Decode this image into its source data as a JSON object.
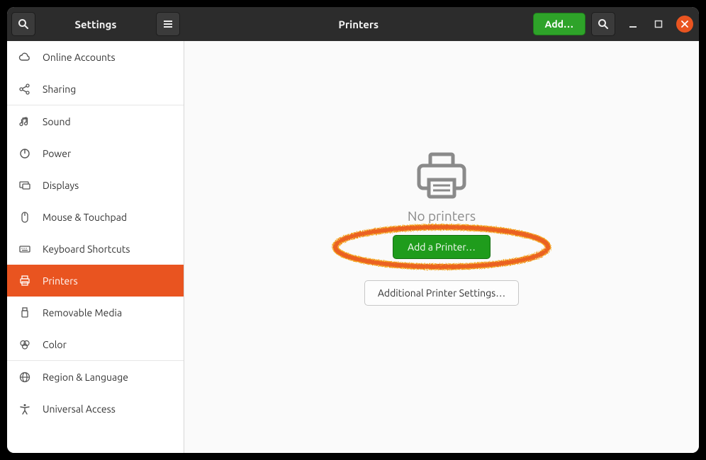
{
  "header": {
    "left_title": "Settings",
    "right_title": "Printers",
    "add_label": "Add…"
  },
  "sidebar": {
    "items": [
      {
        "label": "Online Accounts"
      },
      {
        "label": "Sharing"
      },
      {
        "label": "Sound"
      },
      {
        "label": "Power"
      },
      {
        "label": "Displays"
      },
      {
        "label": "Mouse & Touchpad"
      },
      {
        "label": "Keyboard Shortcuts"
      },
      {
        "label": "Printers"
      },
      {
        "label": "Removable Media"
      },
      {
        "label": "Color"
      },
      {
        "label": "Region & Language"
      },
      {
        "label": "Universal Access"
      }
    ]
  },
  "content": {
    "empty_label": "No printers",
    "add_printer_label": "Add a Printer…",
    "additional_label": "Additional Printer Settings…"
  },
  "colors": {
    "accent": "#e95420",
    "green": "#1f9c1c"
  }
}
